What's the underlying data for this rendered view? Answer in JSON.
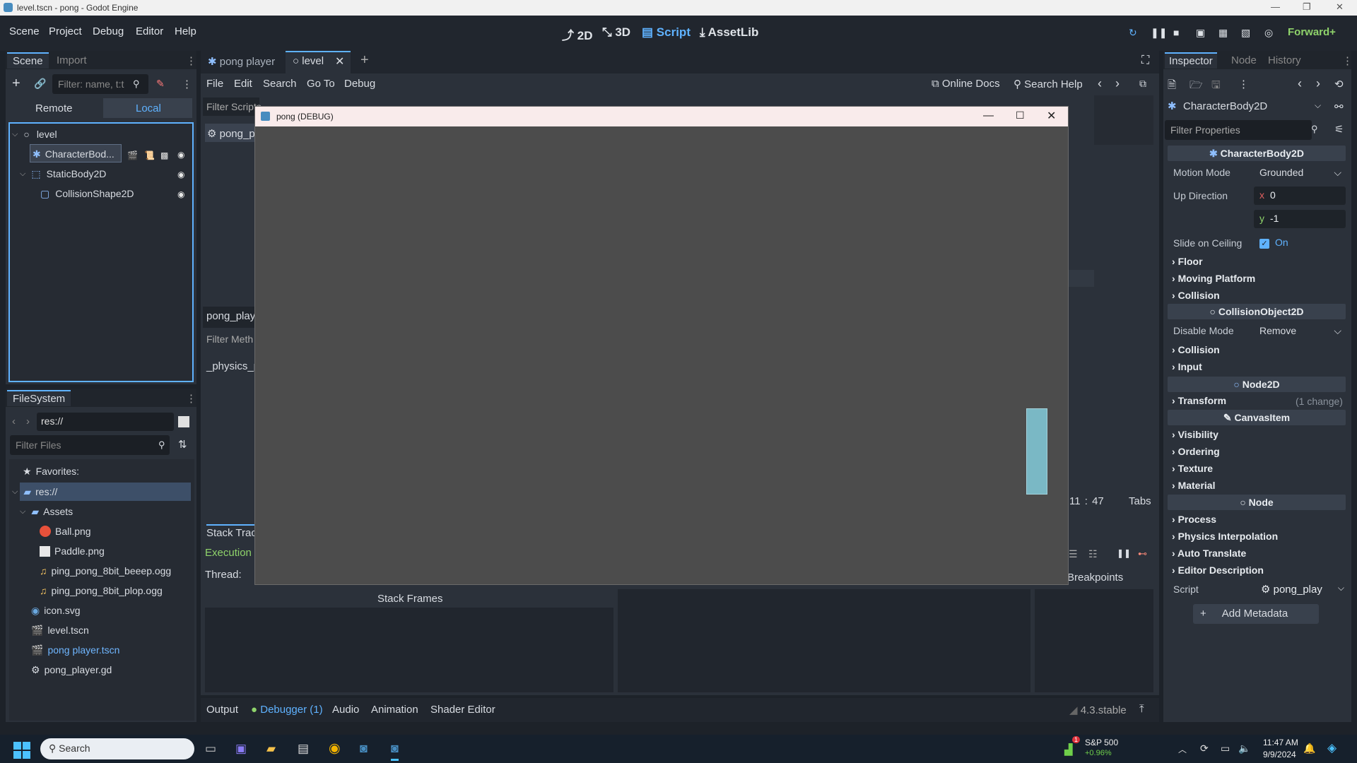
{
  "window": {
    "title": "level.tscn - pong - Godot Engine",
    "controls": [
      "—",
      "❐",
      "✕"
    ]
  },
  "menubar": {
    "menus": [
      "Scene",
      "Project",
      "Debug",
      "Editor",
      "Help"
    ],
    "workspaces": [
      "2D",
      "3D",
      "Script",
      "AssetLib"
    ],
    "active_workspace": "Script",
    "renderer": "Forward+"
  },
  "scene_dock": {
    "tabs": [
      "Scene",
      "Import"
    ],
    "filter_placeholder": "Filter: name, t:t",
    "mode_tabs": [
      "Remote",
      "Local"
    ],
    "active_mode": "Local",
    "tree": [
      {
        "label": "level",
        "indent": 0
      },
      {
        "label": "CharacterBod...",
        "indent": 1,
        "selected": true
      },
      {
        "label": "StaticBody2D",
        "indent": 1
      },
      {
        "label": "CollisionShape2D",
        "indent": 2
      }
    ]
  },
  "filesystem": {
    "title": "FileSystem",
    "path": "res://",
    "filter_placeholder": "Filter Files",
    "items": [
      {
        "label": "Favorites:",
        "type": "favorites"
      },
      {
        "label": "res://",
        "type": "folder",
        "selected": true
      },
      {
        "label": "Assets",
        "type": "folder"
      },
      {
        "label": "Ball.png",
        "type": "image-ball"
      },
      {
        "label": "Paddle.png",
        "type": "image-paddle"
      },
      {
        "label": "ping_pong_8bit_beeep.ogg",
        "type": "audio"
      },
      {
        "label": "ping_pong_8bit_plop.ogg",
        "type": "audio"
      },
      {
        "label": "icon.svg",
        "type": "svg"
      },
      {
        "label": "level.tscn",
        "type": "scene"
      },
      {
        "label": "pong player.tscn",
        "type": "scene-link"
      },
      {
        "label": "pong_player.gd",
        "type": "script"
      }
    ]
  },
  "editor_tabs": {
    "tabs": [
      "pong player",
      "level"
    ],
    "active": "level"
  },
  "script_editor": {
    "menus": [
      "File",
      "Edit",
      "Search",
      "Go To",
      "Debug"
    ],
    "online_docs": "Online Docs",
    "search_help": "Search Help",
    "filter_scripts": "Filter Scripts",
    "script_item": "pong_p",
    "methods_header": "pong_play",
    "filter_methods": "Filter Meth",
    "method_item": "_physics_p",
    "cursor_pos": "11 :   47",
    "indent": "Tabs"
  },
  "debugger": {
    "tab": "Stack Trac",
    "execution": "Execution r",
    "thread_label": "Thread:",
    "stack_frames": "Stack Frames",
    "breakpoints": "Breakpoints"
  },
  "bottom_panel": {
    "tabs": [
      "Output",
      "Debugger (1)",
      "Audio",
      "Animation",
      "Shader Editor"
    ],
    "version": "4.3.stable"
  },
  "debug_window": {
    "title": "pong (DEBUG)",
    "paddle_color": "#7ab8c5",
    "background_color": "#4c4c4c"
  },
  "inspector": {
    "tabs": [
      "Inspector",
      "Node",
      "History"
    ],
    "node_name": "CharacterBody2D",
    "filter_placeholder": "Filter Properties",
    "class_header": "CharacterBody2D",
    "motion_mode_label": "Motion Mode",
    "motion_mode_value": "Grounded",
    "up_direction_label": "Up Direction",
    "up_x": "0",
    "up_y": "-1",
    "slide_label": "Slide on Ceiling",
    "slide_value": "On",
    "groups_1": [
      "Floor",
      "Moving Platform",
      "Collision"
    ],
    "collision_object_header": "CollisionObject2D",
    "disable_mode_label": "Disable Mode",
    "disable_mode_value": "Remove",
    "groups_2": [
      "Collision",
      "Input"
    ],
    "node2d_header": "Node2D",
    "transform_label": "Transform",
    "transform_change": "(1 change)",
    "canvas_header": "CanvasItem",
    "groups_3": [
      "Visibility",
      "Ordering",
      "Texture",
      "Material"
    ],
    "node_header": "Node",
    "groups_4": [
      "Process",
      "Physics Interpolation",
      "Auto Translate",
      "Editor Description"
    ],
    "script_label": "Script",
    "script_value": "pong_play",
    "add_metadata": "Add Metadata"
  },
  "taskbar": {
    "search_placeholder": "Search",
    "stock_name": "S&P 500",
    "stock_change": "+0.96%",
    "stock_badge": "1",
    "time": "11:47 AM",
    "date": "9/9/2024"
  }
}
